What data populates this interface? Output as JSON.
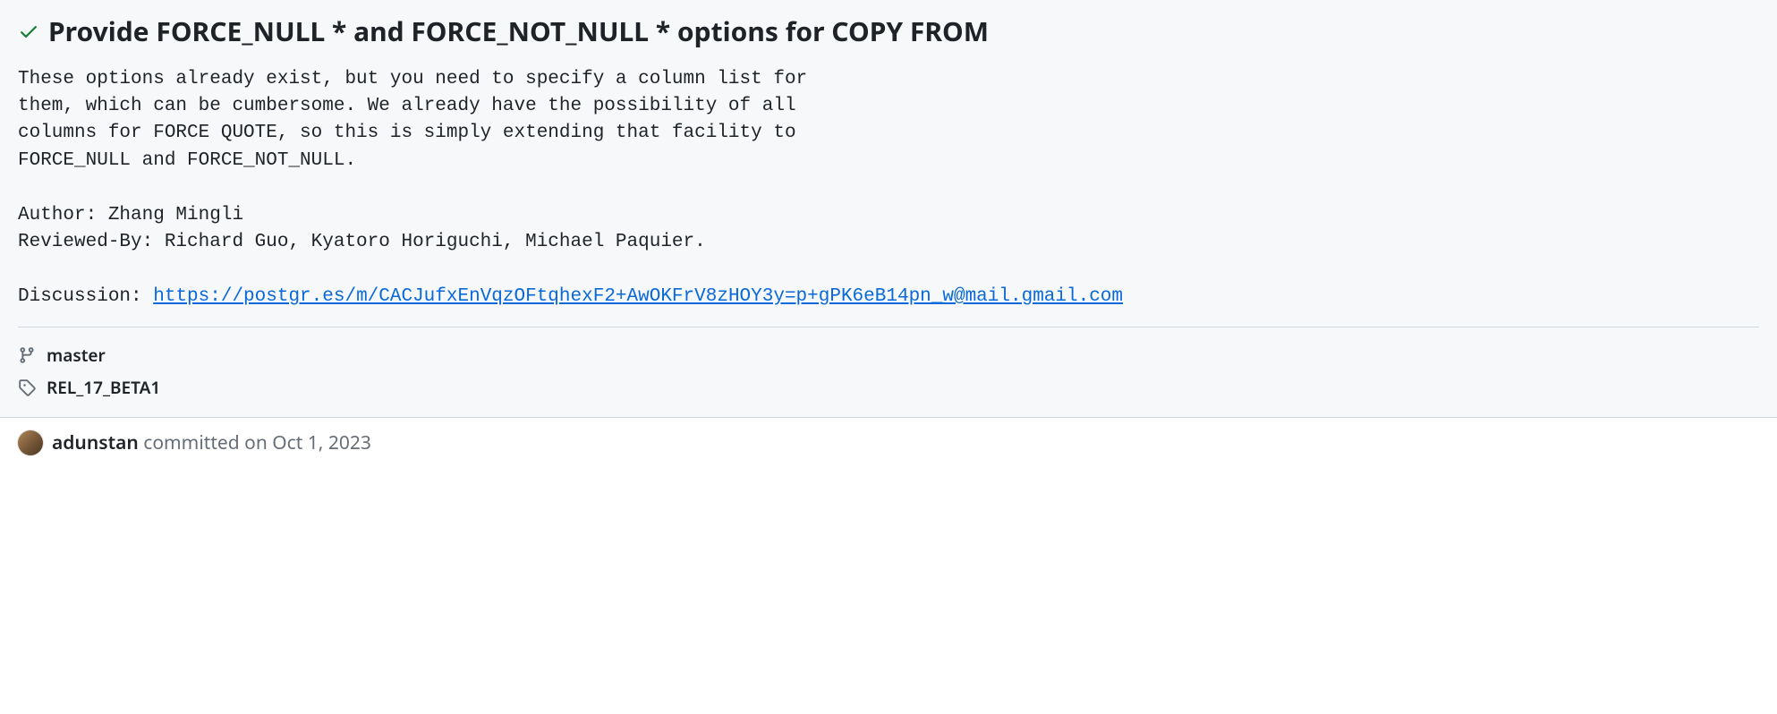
{
  "commit": {
    "title": "Provide FORCE_NULL * and FORCE_NOT_NULL * options for COPY FROM",
    "body_pre_link": "These options already exist, but you need to specify a column list for\nthem, which can be cumbersome. We already have the possibility of all\ncolumns for FORCE QUOTE, so this is simply extending that facility to\nFORCE_NULL and FORCE_NOT_NULL.\n\nAuthor: Zhang Mingli\nReviewed-By: Richard Guo, Kyatoro Horiguchi, Michael Paquier.\n\nDiscussion: ",
    "discussion_link": "https://postgr.es/m/CACJufxEnVqzOFtqhexF2+AwOKFrV8zHOY3y=p+gPK6eB14pn_w@mail.gmail.com"
  },
  "meta": {
    "branch": "master",
    "tag": "REL_17_BETA1"
  },
  "committer": {
    "name": "adunstan",
    "action": "committed ",
    "date": "on Oct 1, 2023"
  }
}
